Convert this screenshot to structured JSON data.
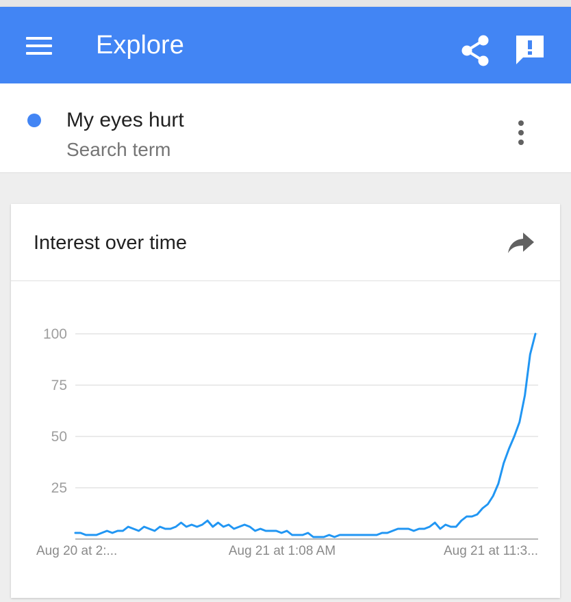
{
  "app_bar": {
    "title": "Explore",
    "menu_icon": "hamburger-menu-icon",
    "share_icon": "share-icon",
    "feedback_icon": "feedback-icon",
    "color": "#4285f4"
  },
  "search_term": {
    "name": "My eyes hurt",
    "type": "Search term",
    "color": "#4285f4",
    "more_icon": "more-vert-icon"
  },
  "card": {
    "title": "Interest over time",
    "action_icon": "forward-share-icon"
  },
  "chart_data": {
    "type": "line",
    "title": "",
    "xlabel": "",
    "ylabel": "",
    "ylim": [
      0,
      100
    ],
    "yticks": [
      25,
      50,
      75,
      100
    ],
    "x_tick_labels": [
      "Aug 20 at 2:...",
      "Aug 21 at 1:08 AM",
      "Aug 21 at 11:3..."
    ],
    "grid": true,
    "series": [
      {
        "color": "#2196f3",
        "values": [
          3,
          3,
          2,
          2,
          2,
          3,
          4,
          3,
          4,
          4,
          6,
          5,
          4,
          6,
          5,
          4,
          6,
          5,
          5,
          6,
          8,
          6,
          7,
          6,
          7,
          9,
          6,
          8,
          6,
          7,
          5,
          6,
          7,
          6,
          4,
          5,
          4,
          4,
          4,
          3,
          4,
          2,
          2,
          2,
          3,
          1,
          1,
          1,
          2,
          1,
          2,
          2,
          2,
          2,
          2,
          2,
          2,
          2,
          3,
          3,
          4,
          5,
          5,
          5,
          4,
          5,
          5,
          6,
          8,
          5,
          7,
          6,
          6,
          9,
          11,
          11,
          12,
          15,
          17,
          21,
          27,
          37,
          44,
          50,
          57,
          70,
          90,
          100
        ]
      }
    ]
  }
}
